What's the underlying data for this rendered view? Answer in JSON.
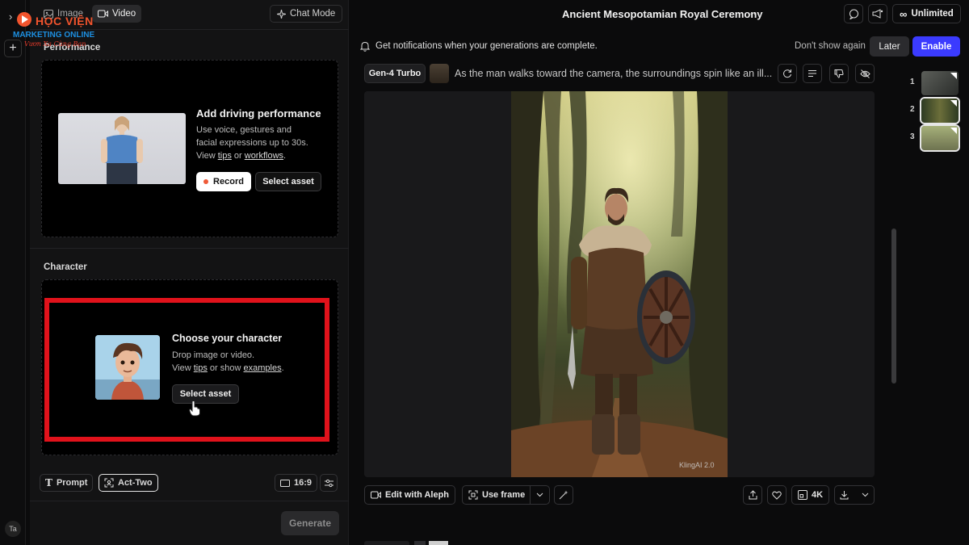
{
  "watermark": {
    "brand": "HỌC VIỆN",
    "subtitle": "MARKETING ONLINE",
    "tagline": "Vươn Xa Cùng Bạn"
  },
  "left_rail": {
    "avatar_text": "Ta"
  },
  "panel": {
    "tabs": [
      {
        "label": "Image",
        "active": false
      },
      {
        "label": "Video",
        "active": true
      }
    ],
    "chat_mode_label": "Chat Mode",
    "performance": {
      "section_title": "Performance",
      "title": "Add driving performance",
      "desc_line1": "Use voice, gestures and",
      "desc_line2": "facial expressions up to 30s.",
      "desc_prefix": "View",
      "tips_link": "tips",
      "or": "or",
      "workflows_link": "workflows",
      "record_label": "Record",
      "select_asset_label": "Select asset"
    },
    "character": {
      "section_title": "Character",
      "title": "Choose your character",
      "desc_line1": "Drop image or video.",
      "desc_prefix": "View",
      "tips_link": "tips",
      "or_show": "or show",
      "examples_link": "examples",
      "select_asset_label": "Select asset"
    },
    "bottom": {
      "prompt_label": "Prompt",
      "act_two_label": "Act-Two",
      "aspect_label": "16:9"
    },
    "generate_label": "Generate"
  },
  "main": {
    "doc_title": "Ancient Mesopotamian Royal Ceremony",
    "more_dots": "···",
    "unlimited_label": "Unlimited",
    "notification": {
      "message": "Get notifications when your generations are complete.",
      "dont_show": "Don't show again",
      "later": "Later",
      "enable": "Enable"
    },
    "generation": {
      "model": "Gen-4 Turbo",
      "prompt": "As the man walks toward the camera, the surroundings spin like an ill..."
    },
    "video_watermark": "KlingAI 2.0",
    "actions": {
      "edit_with_aleph": "Edit with Aleph",
      "use_frame": "Use frame",
      "resolution": "4K"
    },
    "thumbnails": [
      {
        "num": "1",
        "selected": false
      },
      {
        "num": "2",
        "selected": true
      },
      {
        "num": "3",
        "selected": true
      }
    ]
  },
  "colors": {
    "accent_blue": "#3b3bff",
    "highlight_red": "#e0121b",
    "record_dot": "#ef5a38"
  }
}
